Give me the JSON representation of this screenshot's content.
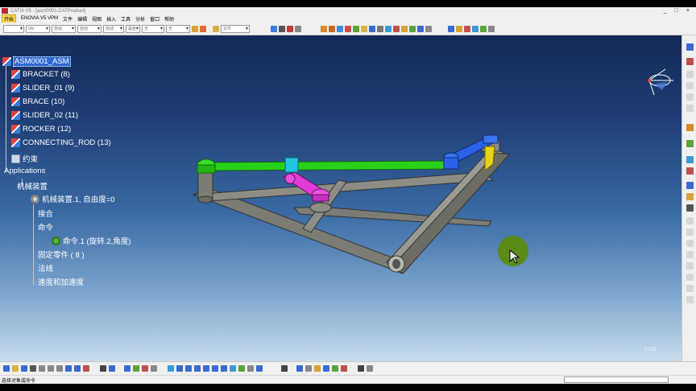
{
  "window": {
    "title": "CATIA V5 - [asm0001.CATProduct]",
    "controls": [
      "_",
      "□",
      "×"
    ]
  },
  "menu": [
    "开始",
    "ENOVIA V5 VPM",
    "文件",
    "编辑",
    "视图",
    "插入",
    "工具",
    "分析",
    "窗口",
    "帮助"
  ],
  "toolbar": {
    "combos": [
      "",
      "0%",
      "自动",
      "自动",
      "自动",
      "黑色",
      "无",
      "无",
      "文件"
    ]
  },
  "tree": {
    "root": "ASM0001_ASM",
    "parts": [
      "BRACKET (8)",
      "SLIDER_01 (9)",
      "BRACE (10)",
      "SLIDER_02 (11)",
      "ROCKER (12)",
      "CONNECTING_ROD (13)"
    ],
    "constraints": "约束",
    "applications": "Applications",
    "mechanism_devices": "机械装置",
    "mechanism": "机械装置.1, 自由度=0",
    "joints": "接合",
    "commands": "命令",
    "command": "命令.1 (旋转.2,角度)",
    "fixed_part": "固定零件 ( 8 )",
    "laws": "法线",
    "speed_accel": "速度和加速度"
  },
  "viewport": {
    "scale_label": "0.385"
  },
  "status": {
    "text": "选择对象或命令"
  },
  "colors": {
    "accent": "#2f6ad1",
    "bg_top": "#142a58",
    "bg_bottom": "#c8dceb",
    "green_part": "#2ad11a",
    "magenta_part": "#e03ad8",
    "blue_part": "#2a62e8",
    "yellow_part": "#e8d21a",
    "frame_part": "#8a8a82"
  }
}
